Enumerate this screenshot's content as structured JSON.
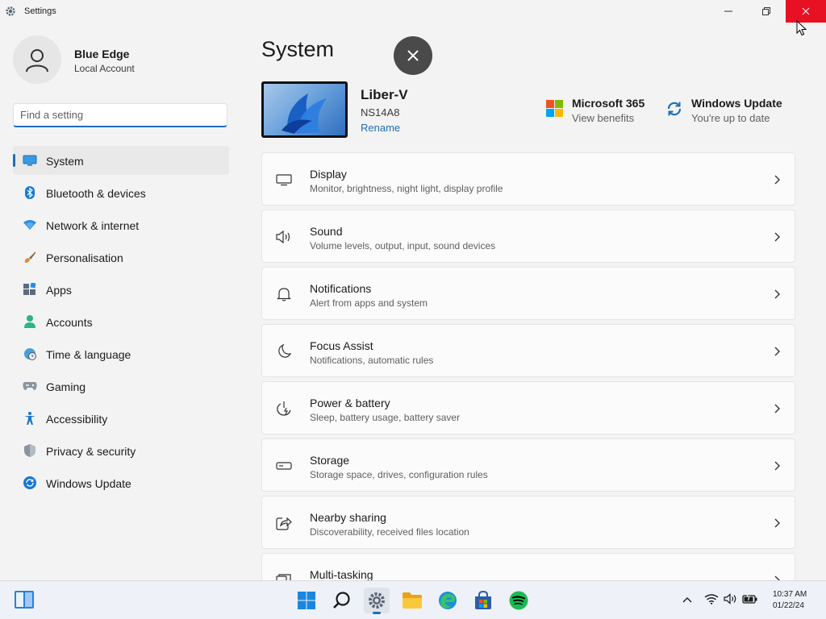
{
  "window": {
    "title": "Settings"
  },
  "user": {
    "name": "Blue Edge",
    "account_type": "Local Account"
  },
  "search": {
    "placeholder": "Find a setting",
    "value": ""
  },
  "nav": [
    {
      "id": "system",
      "label": "System",
      "icon": "monitor-icon",
      "selected": true
    },
    {
      "id": "bluetooth",
      "label": "Bluetooth & devices",
      "icon": "bluetooth-icon"
    },
    {
      "id": "network",
      "label": "Network & internet",
      "icon": "wifi-icon"
    },
    {
      "id": "personalisation",
      "label": "Personalisation",
      "icon": "brush-icon"
    },
    {
      "id": "apps",
      "label": "Apps",
      "icon": "apps-icon"
    },
    {
      "id": "accounts",
      "label": "Accounts",
      "icon": "person-icon"
    },
    {
      "id": "time",
      "label": "Time & language",
      "icon": "globe-clock-icon"
    },
    {
      "id": "gaming",
      "label": "Gaming",
      "icon": "gamepad-icon"
    },
    {
      "id": "accessibility",
      "label": "Accessibility",
      "icon": "accessibility-icon"
    },
    {
      "id": "privacy",
      "label": "Privacy & security",
      "icon": "shield-icon"
    },
    {
      "id": "windows_update",
      "label": "Windows Update",
      "icon": "update-icon"
    }
  ],
  "main": {
    "title": "System",
    "device": {
      "name": "Liber-V",
      "model": "NS14A8",
      "rename_label": "Rename"
    },
    "promos": [
      {
        "title": "Microsoft 365",
        "subtitle": "View benefits",
        "icon": "microsoft-logo-icon"
      },
      {
        "title": "Windows Update",
        "subtitle": "You're up to date",
        "icon": "update-icon"
      }
    ],
    "cards": [
      {
        "title": "Display",
        "subtitle": "Monitor, brightness, night light, display profile",
        "icon": "display-icon"
      },
      {
        "title": "Sound",
        "subtitle": "Volume levels, output, input, sound devices",
        "icon": "speaker-icon"
      },
      {
        "title": "Notifications",
        "subtitle": "Alert from apps and system",
        "icon": "bell-icon"
      },
      {
        "title": "Focus Assist",
        "subtitle": "Notifications, automatic rules",
        "icon": "moon-icon"
      },
      {
        "title": "Power & battery",
        "subtitle": "Sleep, battery usage, battery saver",
        "icon": "power-icon"
      },
      {
        "title": "Storage",
        "subtitle": "Storage space, drives, configuration rules",
        "icon": "storage-icon"
      },
      {
        "title": "Nearby sharing",
        "subtitle": "Discoverability, received files location",
        "icon": "share-icon"
      },
      {
        "title": "Multi-tasking",
        "subtitle": "",
        "icon": "multitask-icon"
      }
    ]
  },
  "taskbar": {
    "apps": [
      "start-icon",
      "search-icon",
      "settings-icon",
      "file-explorer-icon",
      "edge-icon",
      "store-icon",
      "spotify-icon"
    ],
    "active_app": "settings-icon",
    "clock": {
      "time": "10:37 AM",
      "date": "01/22/24"
    }
  },
  "colors": {
    "accent": "#1d6fb8",
    "close_button": "#e81123",
    "spotify": "#1db954"
  }
}
